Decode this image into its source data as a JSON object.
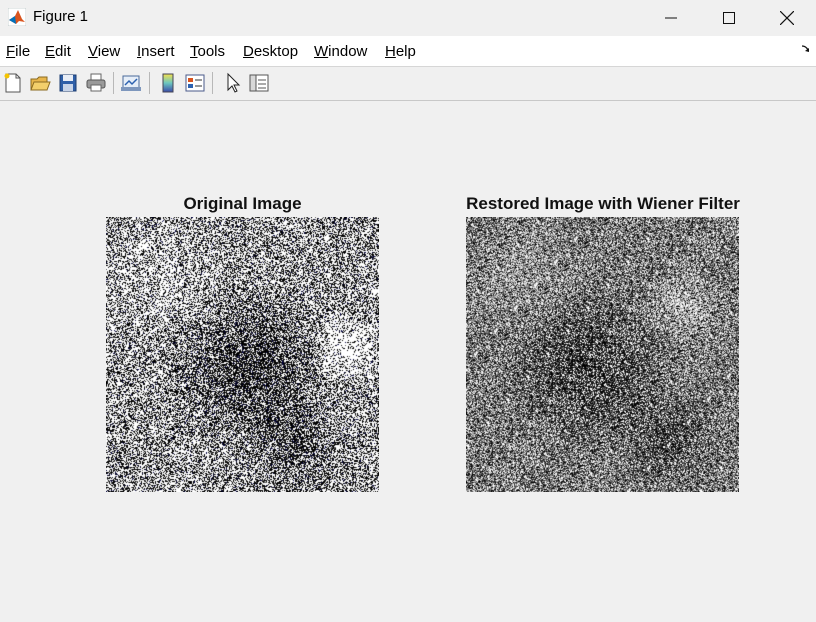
{
  "window": {
    "title": "Figure 1",
    "controls": [
      "minimize",
      "maximize",
      "close"
    ]
  },
  "menu": {
    "items": [
      {
        "label": "File",
        "mnemonic": "F",
        "rest": "ile"
      },
      {
        "label": "Edit",
        "mnemonic": "E",
        "rest": "dit"
      },
      {
        "label": "View",
        "mnemonic": "V",
        "rest": "iew"
      },
      {
        "label": "Insert",
        "mnemonic": "I",
        "rest": "nsert"
      },
      {
        "label": "Tools",
        "mnemonic": "T",
        "rest": "ools"
      },
      {
        "label": "Desktop",
        "mnemonic": "D",
        "rest": "esktop"
      },
      {
        "label": "Window",
        "mnemonic": "W",
        "rest": "indow"
      },
      {
        "label": "Help",
        "mnemonic": "H",
        "rest": "elp"
      }
    ]
  },
  "toolbar": {
    "buttons": [
      "new-figure-icon",
      "open-file-icon",
      "save-icon",
      "print-icon",
      "link-plot-icon",
      "insert-colorbar-icon",
      "insert-legend-icon",
      "edit-plot-cursor-icon",
      "property-inspector-icon"
    ]
  },
  "axes": [
    {
      "title": "Original Image"
    },
    {
      "title": "Restored Image with Wiener Filter"
    }
  ]
}
